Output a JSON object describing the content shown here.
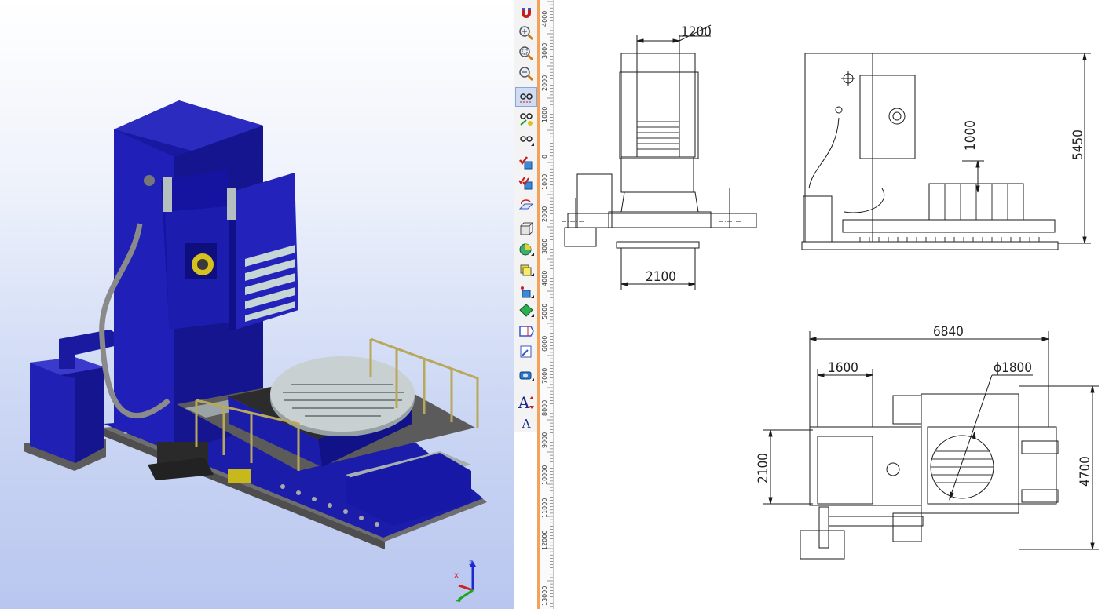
{
  "toolbar": {
    "items": [
      {
        "icon": "magnet-icon"
      },
      {
        "icon": "zoom-in-icon"
      },
      {
        "icon": "zoom-window-icon"
      },
      {
        "icon": "zoom-out-icon"
      },
      {
        "icon": "view-glasses-icon",
        "active": true
      },
      {
        "icon": "view-glasses-pick-icon"
      },
      {
        "icon": "view-glasses-menu-icon"
      },
      {
        "icon": "check-cube-icon"
      },
      {
        "icon": "double-check-cube-icon"
      },
      {
        "icon": "rotate-plane-icon"
      },
      {
        "icon": "box-frame-icon"
      },
      {
        "icon": "shading-sphere-icon"
      },
      {
        "icon": "box-solid-icon"
      },
      {
        "icon": "solid-point-icon"
      },
      {
        "icon": "green-solid-icon"
      },
      {
        "icon": "prism-icon"
      },
      {
        "icon": "document-edit-icon"
      },
      {
        "icon": "camera-icon"
      },
      {
        "icon": "text-scale-up-icon",
        "label": "A"
      },
      {
        "icon": "text-icon",
        "label": "A"
      }
    ]
  },
  "ruler": {
    "labels": [
      "4000",
      "3000",
      "2000",
      "1000",
      "0",
      "1000",
      "2000",
      "3000",
      "4000",
      "5000",
      "6000",
      "7000",
      "8000",
      "9000",
      "10000",
      "11000",
      "12000",
      "13000"
    ]
  },
  "triad": {
    "x": "x",
    "z": "z"
  },
  "drawing": {
    "front_view": {
      "top_width": "1200",
      "base_width": "2100"
    },
    "side_view": {
      "height": "5450",
      "offset": "1000"
    },
    "plan_view": {
      "overall_length": "6840",
      "left_offset": "1600",
      "table_diameter": "ϕ1800",
      "left_height": "2100",
      "overall_width": "4700"
    }
  },
  "colors": {
    "machine_blue": "#1e1ea8",
    "splitter": "#f4a15b",
    "steel": "#8d9699"
  }
}
